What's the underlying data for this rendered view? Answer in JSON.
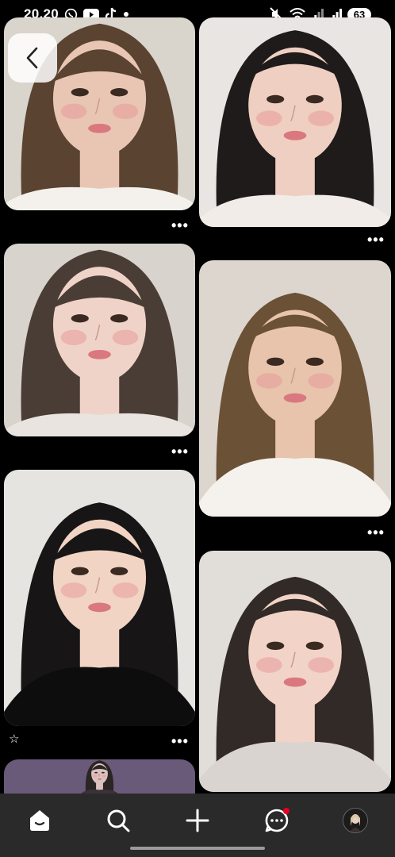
{
  "status_bar": {
    "time": "20.20",
    "battery": "63",
    "left_icons": [
      "whatsapp-icon",
      "youtube-icon",
      "tiktok-icon",
      "dot-icon"
    ],
    "right_icons": [
      "mute-icon",
      "wifi-icon",
      "signal-icon",
      "signal-icon"
    ]
  },
  "pins": [
    {
      "name": "pin-1",
      "column": "left",
      "skin": "#e9c6b4",
      "hair": "#5a4330",
      "bg": "#d9d4cc",
      "cloth": "#f4f1ec"
    },
    {
      "name": "pin-2",
      "column": "right",
      "skin": "#efcfc1",
      "hair": "#1f1b1a",
      "bg": "#e8e5e2",
      "cloth": "#f1ece8"
    },
    {
      "name": "pin-3",
      "column": "left",
      "skin": "#f0d3c8",
      "hair": "#4a3d36",
      "bg": "#d8d3cc",
      "cloth": "#e9e4df"
    },
    {
      "name": "pin-4",
      "column": "right",
      "skin": "#e7c4ab",
      "hair": "#6b5136",
      "bg": "#ddd6ce",
      "cloth": "#f5f2ee"
    },
    {
      "name": "pin-5",
      "column": "left",
      "skin": "#f1d4c4",
      "hair": "#171515",
      "bg": "#e6e4e1",
      "cloth": "#0d0d0d"
    },
    {
      "name": "pin-6",
      "column": "right",
      "skin": "#f2d3c8",
      "hair": "#322a27",
      "bg": "#e1ddd8",
      "cloth": "#d9d4cf"
    },
    {
      "name": "pin-7",
      "column": "left",
      "skin": "#d9c2bf",
      "hair": "#2b2524",
      "bg": "#6a5a7a",
      "cloth": "#3a3238"
    }
  ],
  "more_label": "•••",
  "star_label": "☆",
  "colors": {
    "background": "#000000",
    "nav_bg": "#2a2a2a",
    "notification": "#e60023"
  },
  "bottom_nav": [
    {
      "name": "home-icon"
    },
    {
      "name": "search-icon"
    },
    {
      "name": "create-icon"
    },
    {
      "name": "messages-icon"
    },
    {
      "name": "profile-avatar"
    }
  ]
}
